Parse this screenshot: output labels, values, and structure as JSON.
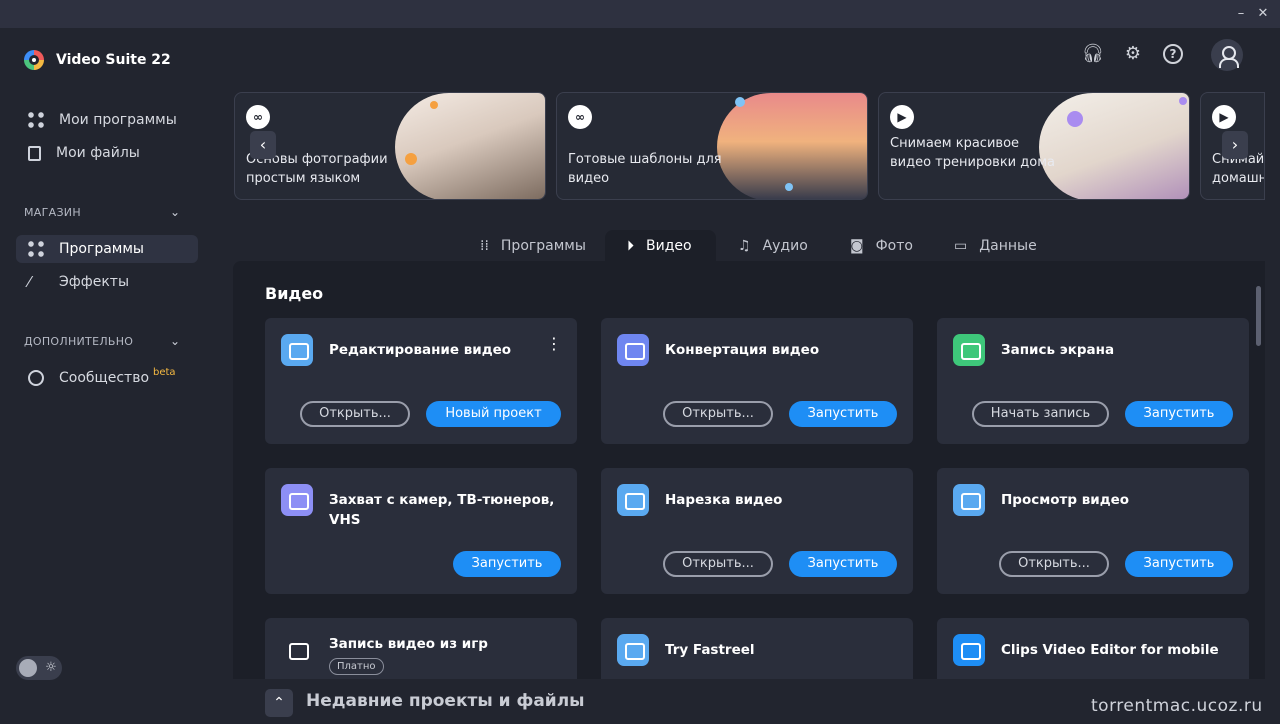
{
  "window": {
    "minimize": "–",
    "close": "✕"
  },
  "app": {
    "title": "Video Suite 22"
  },
  "sidebar": {
    "top_items": [
      {
        "label": "Мои программы",
        "icon": "grid-icon"
      },
      {
        "label": "Мои файлы",
        "icon": "files-icon"
      }
    ],
    "store_section": "МАГАЗИН",
    "store_items": [
      {
        "label": "Программы",
        "icon": "apps-add-icon"
      },
      {
        "label": "Эффекты",
        "icon": "magic-wand-icon"
      }
    ],
    "extra_section": "ДОПОЛНИТЕЛЬНО",
    "extra_items": [
      {
        "label": "Сообщество",
        "badge": "beta",
        "icon": "chat-bubble-icon"
      }
    ]
  },
  "header_icons": [
    "headset-icon",
    "gear-icon",
    "help-icon",
    "user-avatar-icon"
  ],
  "banners": [
    {
      "text": "Основы фотографии простым языком",
      "icon": "link-icon"
    },
    {
      "text": "Готовые шаблоны для видео",
      "icon": "link-icon"
    },
    {
      "text": "Снимаем красивое видео тренировки дома",
      "icon": "play-icon"
    },
    {
      "text": "Снимай домашн",
      "icon": "play-icon"
    }
  ],
  "tabs": [
    {
      "label": "Программы",
      "icon": "grid-icon"
    },
    {
      "label": "Видео",
      "icon": "play-circle-icon"
    },
    {
      "label": "Аудио",
      "icon": "music-note-icon"
    },
    {
      "label": "Фото",
      "icon": "camera-icon"
    },
    {
      "label": "Данные",
      "icon": "folder-icon"
    }
  ],
  "content": {
    "title": "Видео",
    "cards": [
      {
        "title": "Редактирование видео",
        "secondary": "Открыть...",
        "primary": "Новый проект",
        "icon_color": "#5aa9f0"
      },
      {
        "title": "Конвертация видео",
        "secondary": "Открыть...",
        "primary": "Запустить",
        "icon_color": "#6f86f0"
      },
      {
        "title": "Запись экрана",
        "secondary": "Начать запись",
        "primary": "Запустить",
        "icon_color": "#3ec77a"
      },
      {
        "title": "Захват с камер, ТВ-тюнеров, VHS",
        "primary": "Запустить",
        "icon_color": "#8d8ff5"
      },
      {
        "title": "Нарезка видео",
        "secondary": "Открыть...",
        "primary": "Запустить",
        "icon_color": "#5aa9f0"
      },
      {
        "title": "Просмотр видео",
        "secondary": "Открыть...",
        "primary": "Запустить",
        "icon_color": "#5aa9f0"
      },
      {
        "title": "Запись видео из игр",
        "badge": "Платно",
        "icon_color": "#f5b942"
      },
      {
        "title": "Try Fastreel",
        "icon_color": "#5aa9f0"
      },
      {
        "title": "Clips Video Editor for mobile",
        "icon_color": "#1e8ef5"
      }
    ]
  },
  "bottom": {
    "title": "Недавние проекты и файлы"
  },
  "watermark": "torrentmac.ucoz.ru",
  "colors": {
    "accent": "#1e8ef5",
    "background": "#22252f",
    "panel": "#1c1f28",
    "card": "#2a2e3b"
  }
}
